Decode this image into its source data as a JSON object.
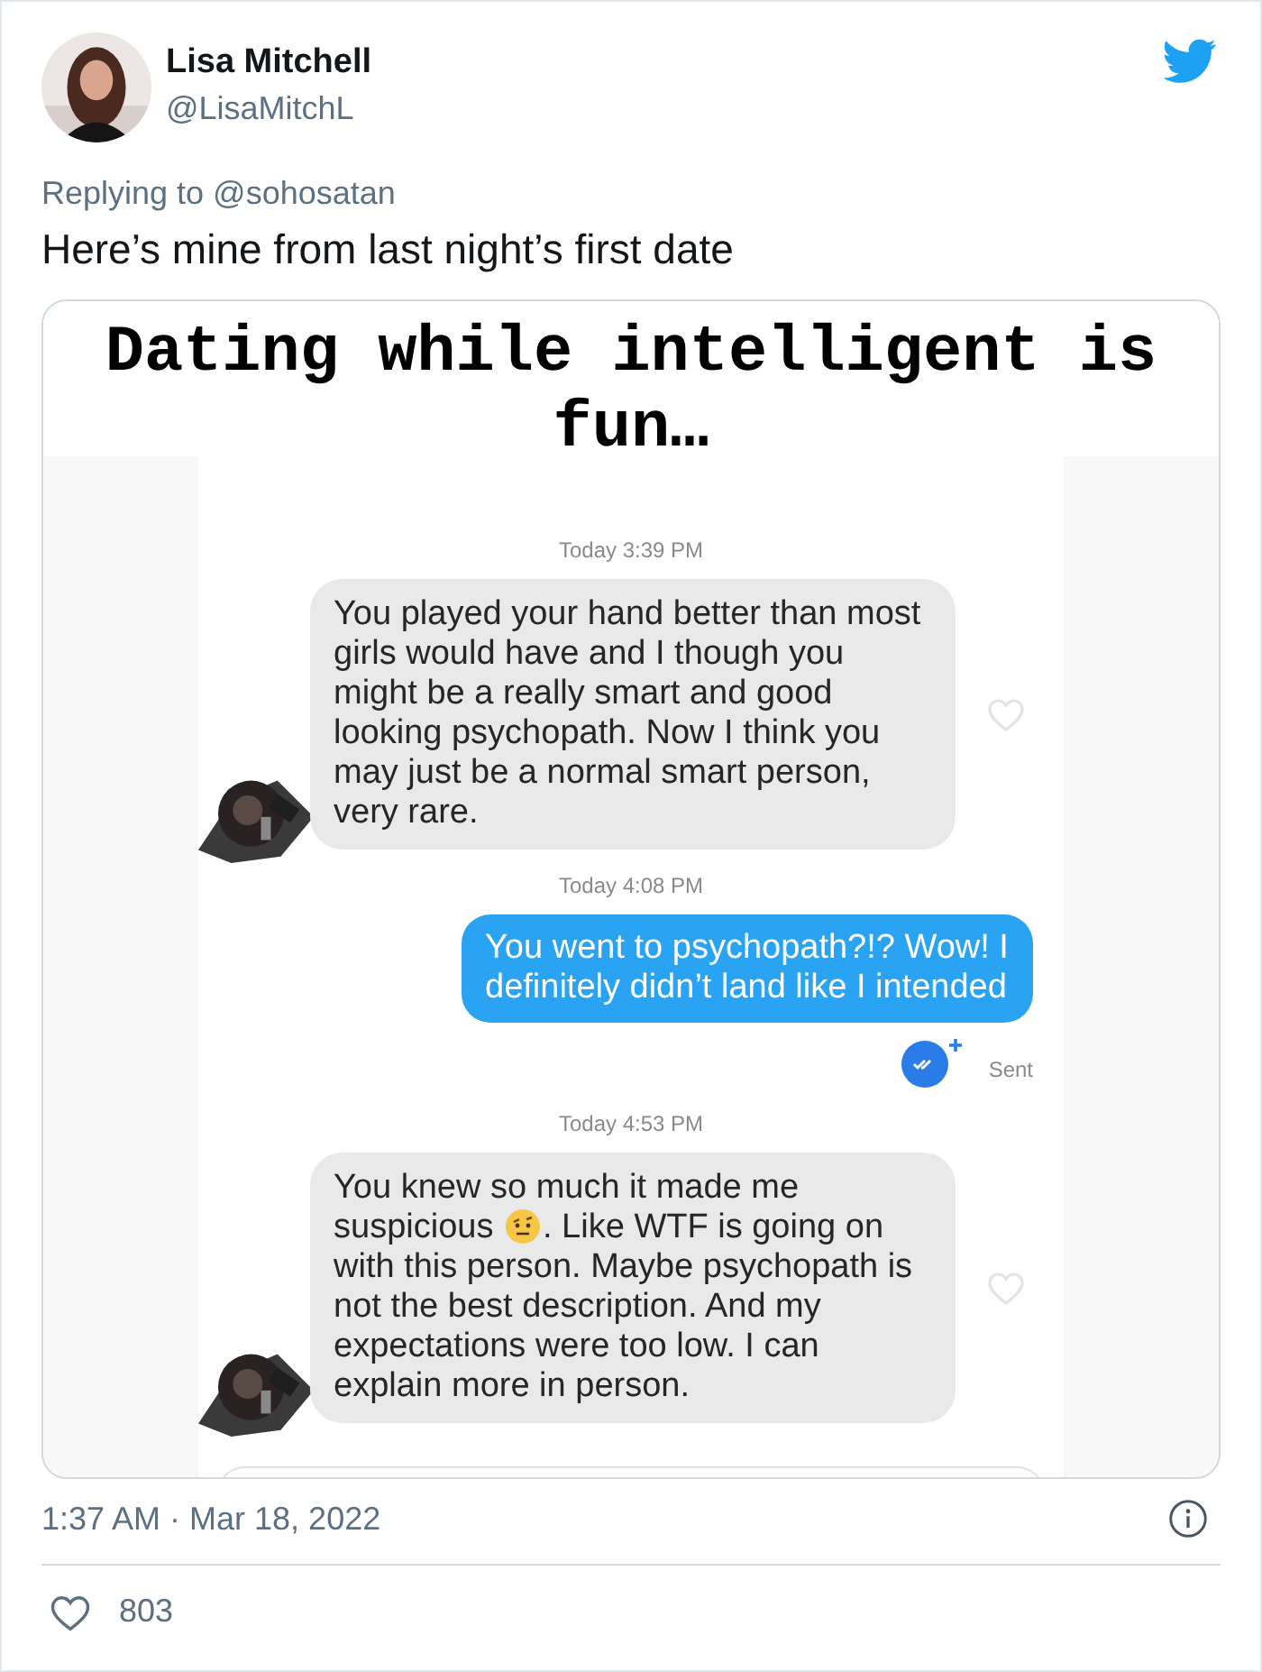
{
  "author": {
    "name": "Lisa Mitchell",
    "handle": "@LisaMitchL"
  },
  "reply_to": "Replying to @sohosatan",
  "text": "Here’s mine from last night’s first date",
  "media": {
    "heading": "Dating while intelligent is fun…",
    "messages": [
      {
        "kind": "timestamp",
        "text": "Today 3:39 PM"
      },
      {
        "kind": "received",
        "liked": false,
        "parts": [
          {
            "kind": "text",
            "text": "You played your hand better than most girls would have and I though you might be a really smart and good looking psychopath. Now I think you may just be a normal smart person, very rare."
          }
        ]
      },
      {
        "kind": "timestamp",
        "text": "Today 4:08 PM"
      },
      {
        "kind": "sent",
        "status": "Sent",
        "parts": [
          {
            "kind": "text",
            "text": "You went to psychopath?!? Wow! I definitely didn’t land like I intended"
          }
        ]
      },
      {
        "kind": "timestamp",
        "text": "Today 4:53 PM"
      },
      {
        "kind": "received",
        "liked": false,
        "parts": [
          {
            "kind": "text",
            "text": "You knew so much it made me suspicious "
          },
          {
            "kind": "emoji"
          },
          {
            "kind": "text",
            "text": ". Like WTF is going on with this person. Maybe psychopath is not the best description. And my expectations were too low. I can explain more in person."
          }
        ]
      }
    ]
  },
  "timestamp": "1:37 AM · Mar 18, 2022",
  "likes": "803"
}
